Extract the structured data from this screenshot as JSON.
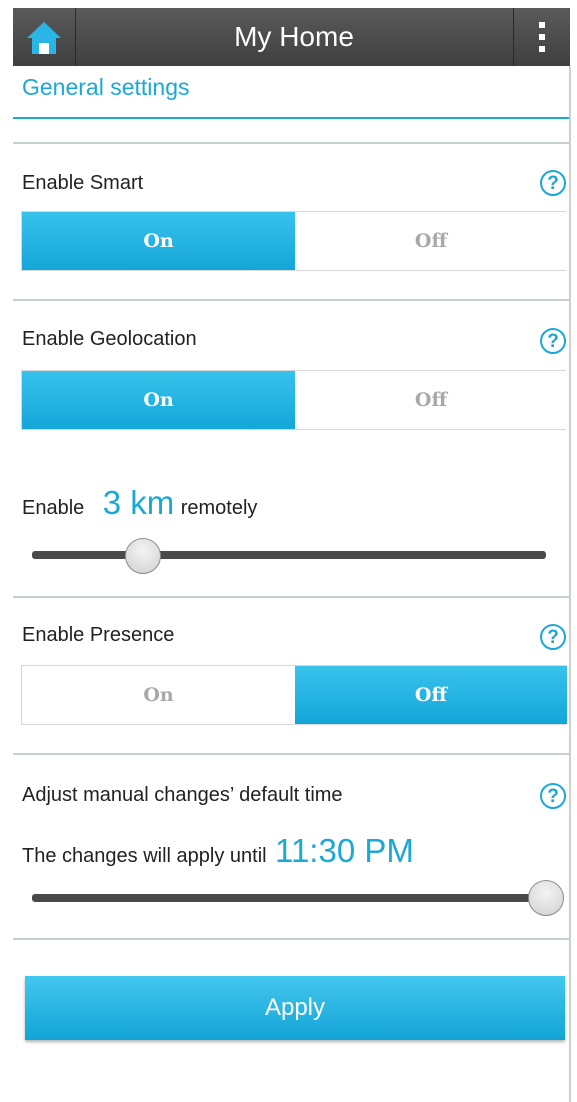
{
  "header": {
    "title": "My Home",
    "home_icon": "home-icon",
    "menu_icon": "more-vertical-icon"
  },
  "section_title": "General settings",
  "smart": {
    "label": "Enable Smart",
    "help": "?",
    "on_label": "On",
    "off_label": "Off",
    "selected": "On"
  },
  "geolocation": {
    "label": "Enable Geolocation",
    "help": "?",
    "on_label": "On",
    "off_label": "Off",
    "selected": "On",
    "range_prefix": "Enable",
    "range_value": "3 km",
    "range_suffix": "remotely",
    "slider_fraction": 0.15
  },
  "presence": {
    "label": "Enable Presence",
    "help": "?",
    "on_label": "On",
    "off_label": "Off",
    "selected": "Off"
  },
  "manual_changes": {
    "label": "Adjust manual changes’ default time",
    "help": "?",
    "until_prefix": "The changes will apply until",
    "until_value": "11:30 PM",
    "slider_fraction": 1.0
  },
  "apply_label": "Apply",
  "colors": {
    "accent": "#1ba8d6",
    "header": "#4b4b4b"
  }
}
